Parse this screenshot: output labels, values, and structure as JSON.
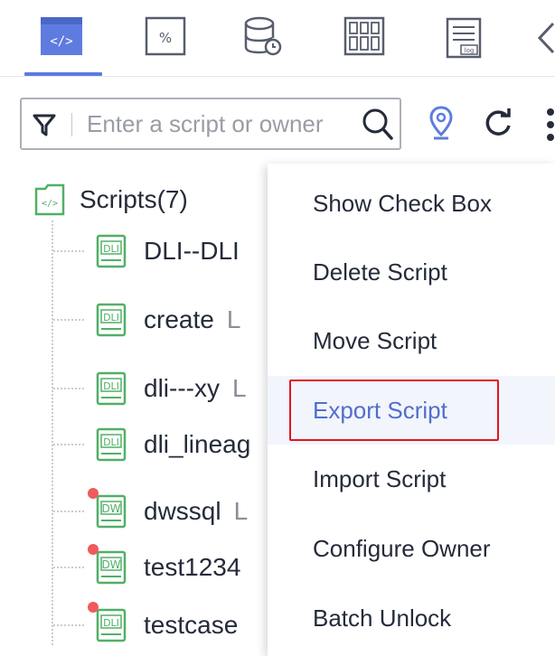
{
  "toolbar": {
    "tabs": [
      {
        "icon": "code-tab-icon",
        "active": true
      },
      {
        "icon": "function-tab-icon",
        "active": false
      },
      {
        "icon": "database-tab-icon",
        "active": false
      },
      {
        "icon": "table-tab-icon",
        "active": false
      },
      {
        "icon": "log-tab-icon",
        "active": false
      }
    ],
    "overflow_icon": "chevron-left-icon",
    "accent_color": "#5e7ce0"
  },
  "search": {
    "value": "",
    "placeholder": "Enter a script or owner",
    "filter_icon": "filter-icon",
    "search_icon": "search-icon",
    "locate_icon": "location-icon",
    "refresh_icon": "refresh-icon",
    "more_icon": "more-vertical-icon"
  },
  "tree": {
    "root": {
      "label": "Scripts(7)",
      "icon": "code-folder-icon"
    },
    "items": [
      {
        "name": "DLI--DLI",
        "owner": "",
        "badge": "DLI",
        "modified": false
      },
      {
        "name": "create",
        "owner": "L",
        "badge": "DLI",
        "modified": false
      },
      {
        "name": "dli---xy",
        "owner": "L",
        "badge": "DLI",
        "modified": false
      },
      {
        "name": "dli_lineag",
        "owner": "",
        "badge": "DLI",
        "modified": false
      },
      {
        "name": "dwssql",
        "owner": "L",
        "badge": "DW",
        "modified": true
      },
      {
        "name": "test1234",
        "owner": "",
        "badge": "DW",
        "modified": true
      },
      {
        "name": "testcase",
        "owner": "",
        "badge": "DLI",
        "modified": true
      }
    ],
    "badge_color": "#50b066",
    "dot_color": "#f05a5a"
  },
  "menu": {
    "items": [
      {
        "label": "Show Check Box"
      },
      {
        "label": "Delete Script"
      },
      {
        "label": "Move Script"
      },
      {
        "label": "Export Script",
        "active": true,
        "highlighted": true
      },
      {
        "label": "Import Script"
      },
      {
        "label": "Configure Owner"
      },
      {
        "label": "Batch Unlock"
      }
    ],
    "active_color": "#526ecc",
    "highlight_color": "#e5141f"
  }
}
